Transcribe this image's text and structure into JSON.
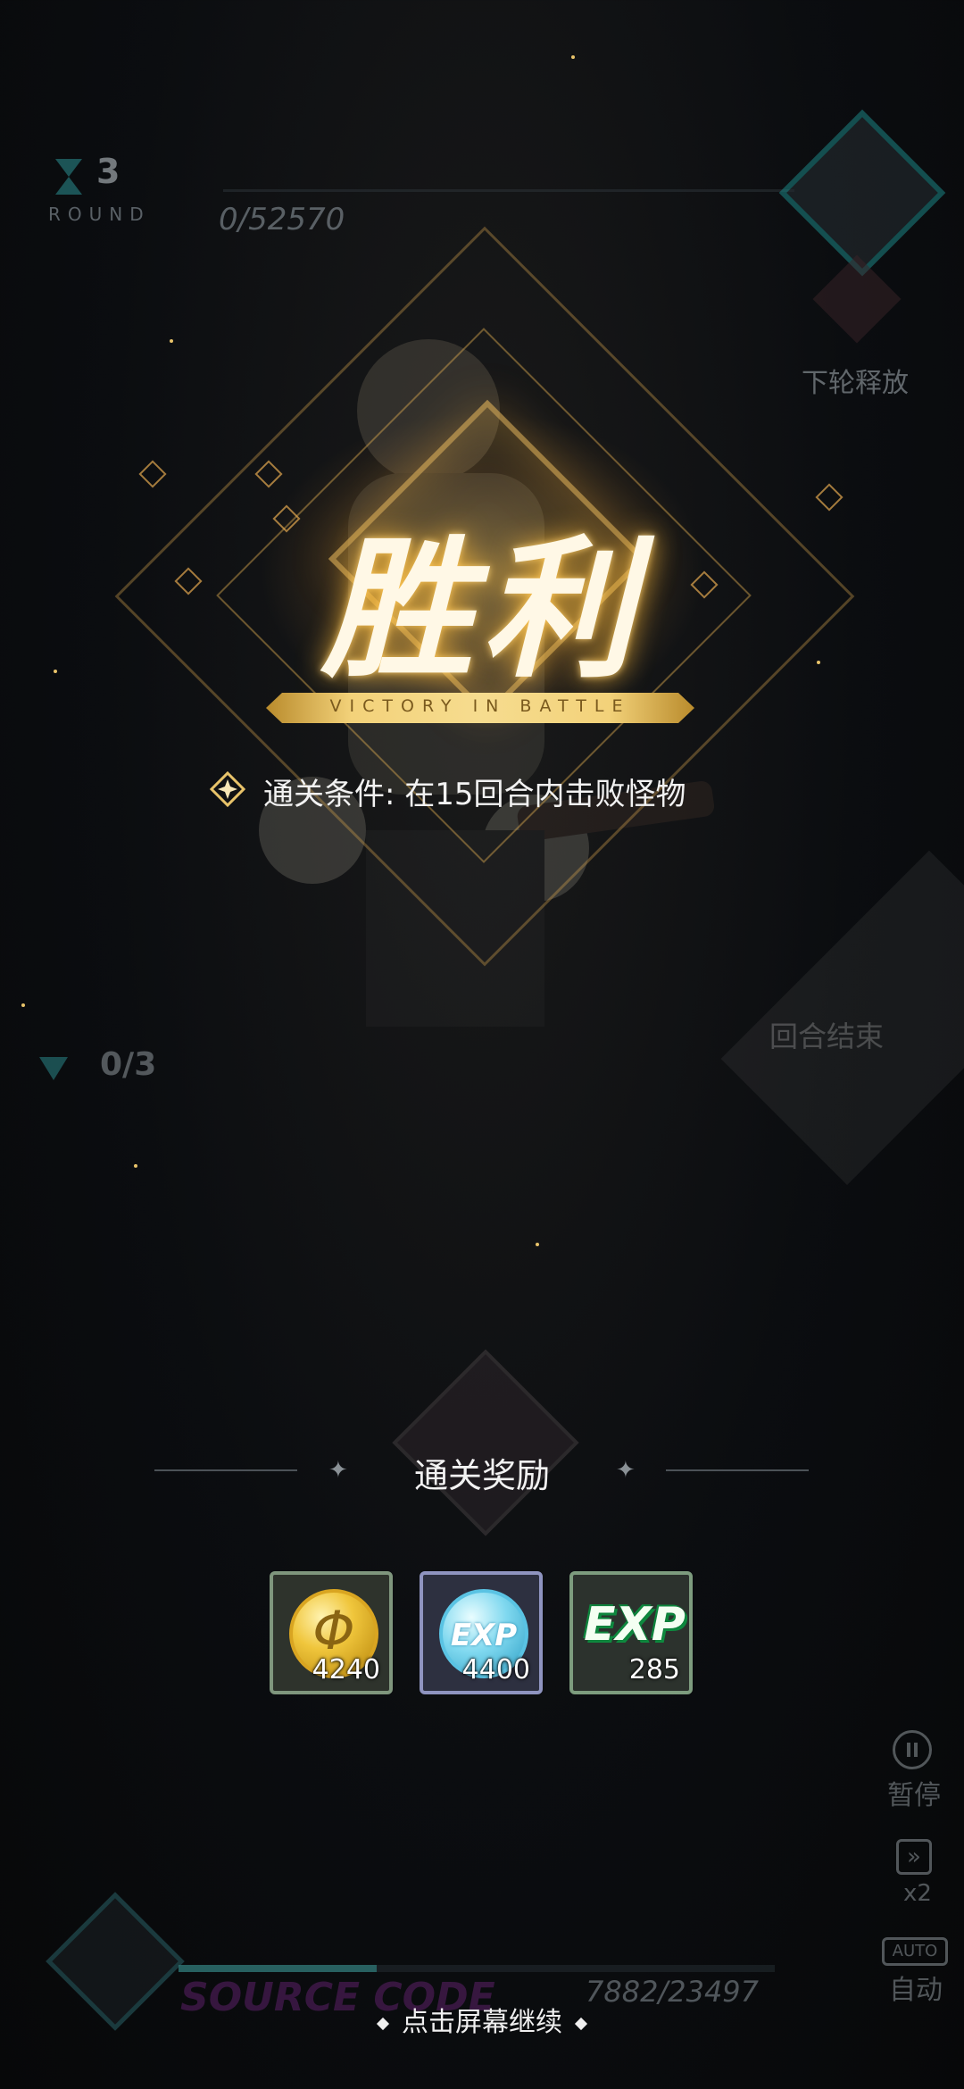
{
  "hud": {
    "round_number": "3",
    "round_label": "ROUND",
    "boss_hp": "0/52570",
    "next_release": "下轮释放",
    "kills": "0/3",
    "end_turn": "回合结束"
  },
  "victory": {
    "title": "胜利",
    "subtitle": "VICTORY IN BATTLE",
    "condition": "通关条件: 在15回合内击败怪物"
  },
  "rewards": {
    "title": "通关奖励",
    "items": [
      {
        "icon": "gold-coin-icon",
        "count": "4240",
        "coin_glyph": "Φ"
      },
      {
        "icon": "exp-coin-icon",
        "count": "4400",
        "coin_glyph": "EXP"
      },
      {
        "icon": "exp-book-icon",
        "count": "285",
        "coin_glyph": "EXP"
      }
    ]
  },
  "controls": {
    "pause": "暂停",
    "speed_glyph": "»",
    "speed": "x2",
    "auto_icon": "AUTO",
    "auto": "自动"
  },
  "bottom": {
    "source_code": "SOURCE CODE",
    "energy": "7882/23497",
    "continue": "点击屏幕继续"
  },
  "colors": {
    "gold_accent": "#f3d27a",
    "teal_frame": "#1a7b7b",
    "background": "#0b0d10"
  }
}
